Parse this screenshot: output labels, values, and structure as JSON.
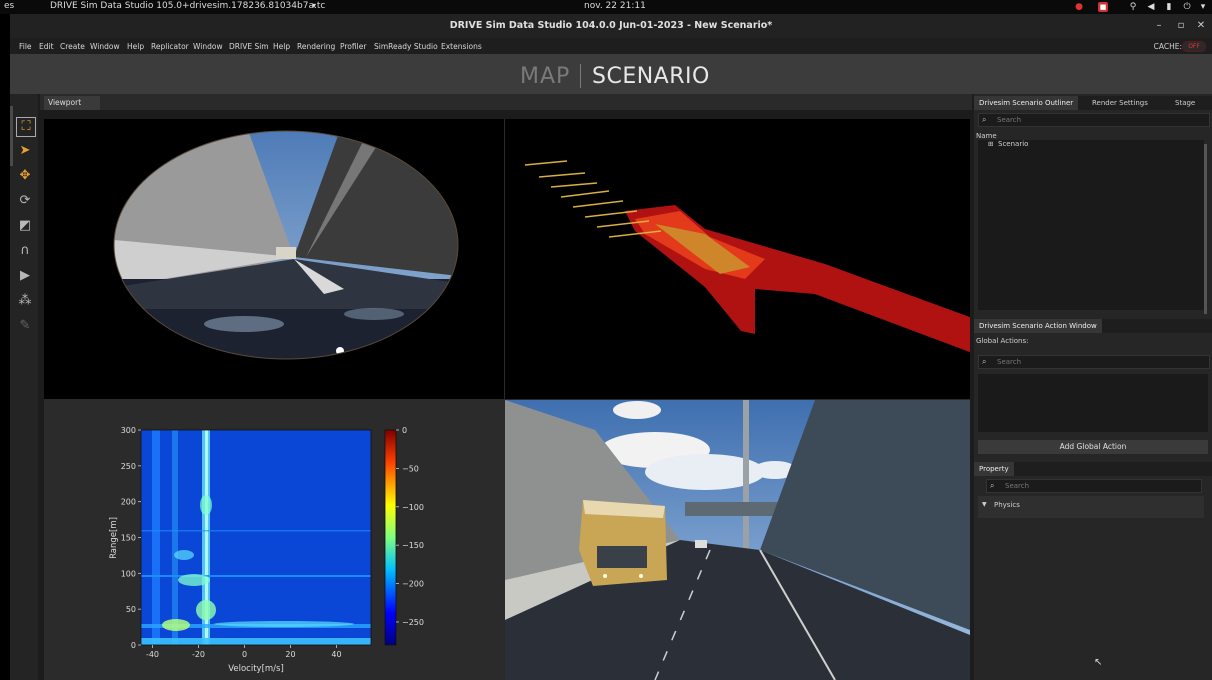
{
  "os_bar": {
    "left_text": "es",
    "app_label": "DRIVE Sim Data Studio 105.0+drivesim.178236.81034b7a.tc",
    "clock": "nov. 22  21:11"
  },
  "window": {
    "title": "DRIVE Sim Data Studio 104.0.0 Jun-01-2023 - New Scenario*"
  },
  "menu": [
    "File",
    "Edit",
    "Create",
    "Window",
    "Help",
    "Replicator",
    "Window",
    "DRIVE Sim",
    "Help",
    "Rendering",
    "Profiler",
    "SimReady Studio",
    "Extensions"
  ],
  "cache": {
    "label": "CACHE:",
    "toggle": "OFF"
  },
  "modes": {
    "map": "MAP",
    "scenario": "SCENARIO"
  },
  "viewport": {
    "tab_label": "Viewport"
  },
  "outliner": {
    "tabs": [
      "Drivesim Scenario Outliner",
      "Render Settings",
      "Stage"
    ],
    "search_placeholder": "Search",
    "column_name": "Name",
    "root_item": "Scenario"
  },
  "action_window": {
    "tab": "Drivesim Scenario Action Window",
    "global_actions_label": "Global Actions:",
    "search_placeholder": "Search",
    "add_button": "Add Global Action"
  },
  "property": {
    "tab": "Property",
    "search_placeholder": "Search",
    "section": "Physics"
  },
  "chart_data": {
    "type": "heatmap",
    "xlabel": "Velocity[m/s]",
    "ylabel": "Range[m]",
    "xlim": [
      -45,
      55
    ],
    "ylim": [
      0,
      300
    ],
    "xticks": [
      -40,
      -20,
      0,
      20,
      40
    ],
    "yticks": [
      0,
      50,
      100,
      150,
      200,
      250,
      300
    ],
    "colorbar": {
      "range": [
        -280,
        0
      ],
      "ticks": [
        0,
        -50,
        -100,
        -150,
        -200,
        -250
      ]
    }
  }
}
